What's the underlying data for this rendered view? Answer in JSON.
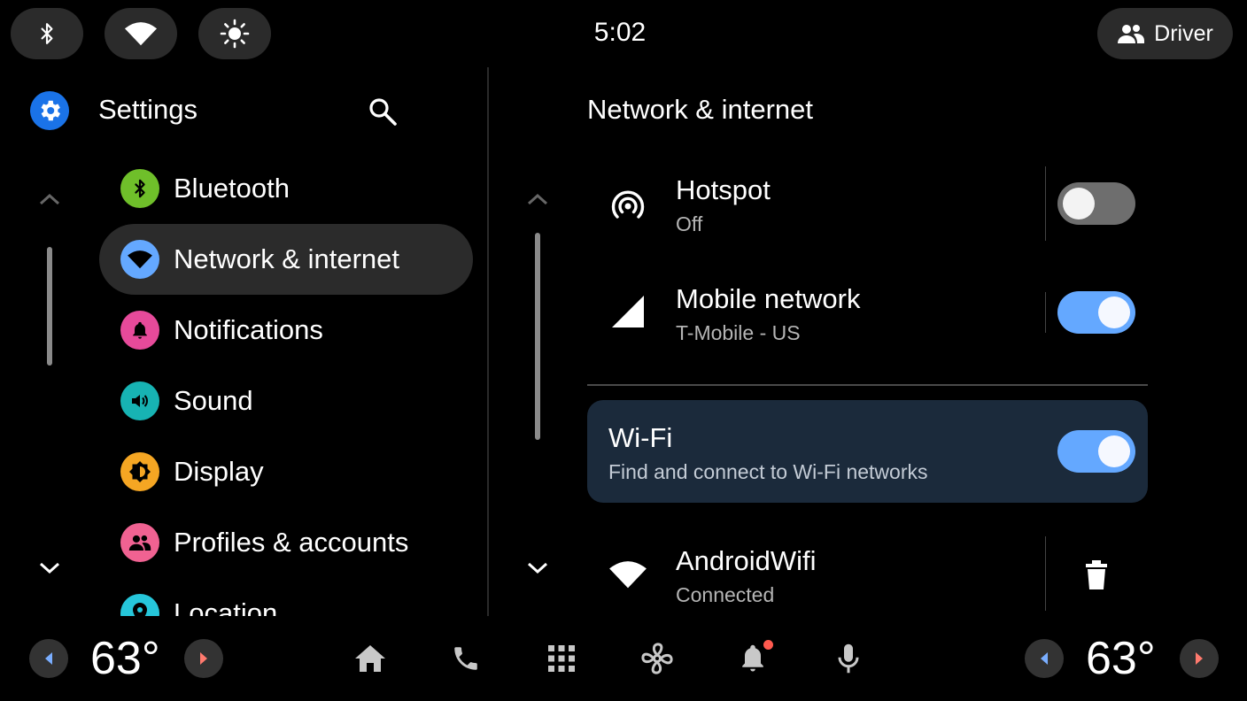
{
  "status_bar": {
    "clock": "5:02",
    "user_label": "Driver",
    "quick_settings": [
      "bluetooth-icon",
      "wifi-icon",
      "brightness-icon"
    ]
  },
  "settings": {
    "title": "Settings",
    "menu": [
      {
        "label": "Bluetooth",
        "icon": "bluetooth-icon",
        "color": "#6fbf2a"
      },
      {
        "label": "Network & internet",
        "icon": "wifi-icon",
        "color": "#64a8ff",
        "active": true
      },
      {
        "label": "Notifications",
        "icon": "bell-icon",
        "color": "#e64a9a"
      },
      {
        "label": "Sound",
        "icon": "volume-icon",
        "color": "#17b3b3"
      },
      {
        "label": "Display",
        "icon": "brightness-icon",
        "color": "#f5a623"
      },
      {
        "label": "Profiles & accounts",
        "icon": "people-icon",
        "color": "#f06292"
      },
      {
        "label": "Location",
        "icon": "location-icon",
        "color": "#26c6da"
      }
    ]
  },
  "network": {
    "title": "Network & internet",
    "hotspot": {
      "title": "Hotspot",
      "subtitle": "Off",
      "enabled": false
    },
    "mobile": {
      "title": "Mobile network",
      "subtitle": "T-Mobile - US",
      "enabled": true
    },
    "wifi": {
      "title": "Wi-Fi",
      "subtitle": "Find and connect to Wi-Fi networks",
      "enabled": true
    },
    "saved_network": {
      "title": "AndroidWifi",
      "subtitle": "Connected"
    }
  },
  "climate": {
    "left_temp": "63°",
    "right_temp": "63°"
  },
  "dock": [
    "home-icon",
    "phone-icon",
    "apps-grid-icon",
    "fan-icon",
    "notification-bell-icon",
    "microphone-icon"
  ],
  "colors": {
    "accent": "#64a8ff",
    "card_bg": "#1b2a3b",
    "pill_bg": "#2b2b2b",
    "notification_dot": "#ff5a4f"
  }
}
